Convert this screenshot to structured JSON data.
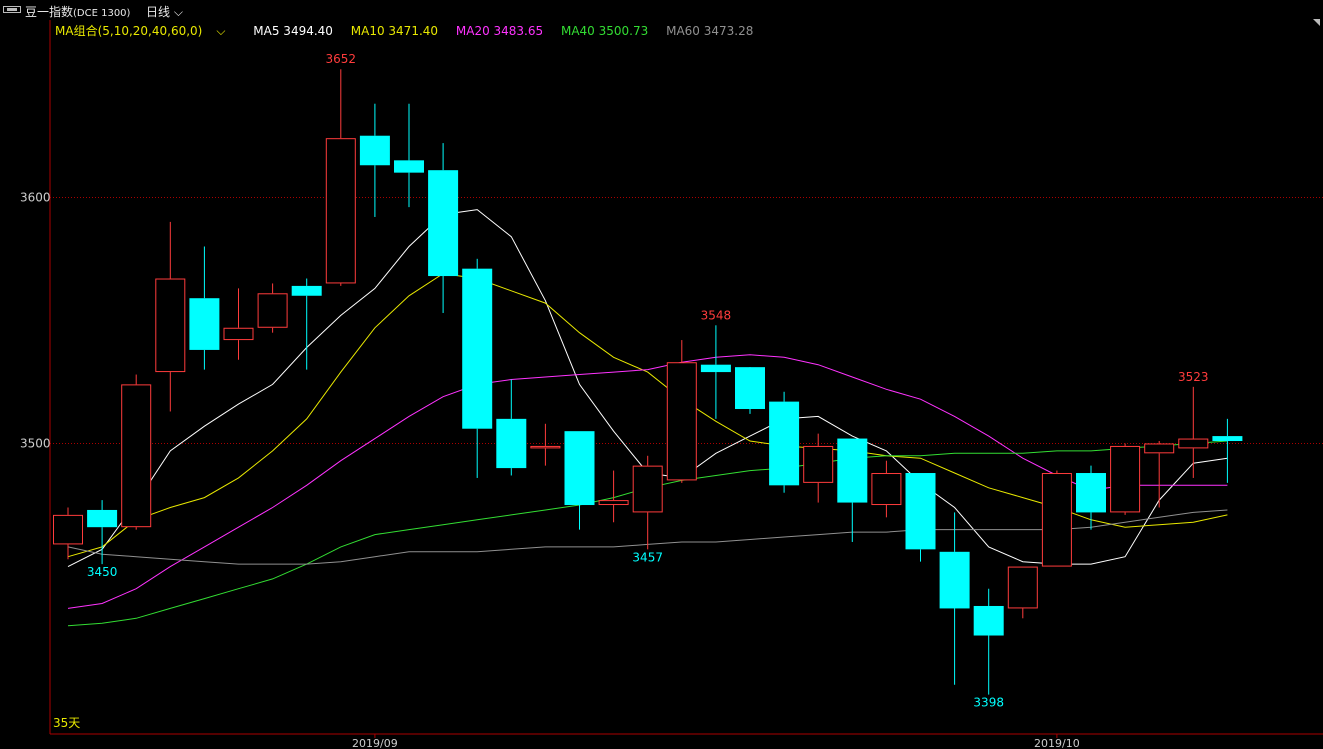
{
  "header": {
    "title": "豆一指数",
    "code": "(DCE 1300)",
    "period": "日线"
  },
  "ma_legend": {
    "combo": "MA组合(5,10,20,40,60,0)",
    "items": [
      {
        "label": "MA5 3494.40",
        "color": "#ffffff"
      },
      {
        "label": "MA10 3471.40",
        "color": "#e8e800"
      },
      {
        "label": "MA20 3483.65",
        "color": "#ff33ff"
      },
      {
        "label": "MA40 3500.73",
        "color": "#33dd33"
      },
      {
        "label": "MA60 3473.28",
        "color": "#909090"
      }
    ]
  },
  "footer": {
    "days": "35天"
  },
  "colors": {
    "up": "#ff3c3c",
    "down": "#00ffff",
    "ma5": "#ffffff",
    "ma10": "#e8e800",
    "ma20": "#ff33ff",
    "ma40": "#33dd33",
    "ma60": "#909090",
    "axis": "#aa0000",
    "grid": "#aa0000"
  },
  "chart_data": {
    "type": "candlestick",
    "y_ticks": [
      3600,
      3500
    ],
    "ylim": [
      3382,
      3672
    ],
    "x_tick_labels": [
      {
        "label": "2019/09",
        "index": 9
      },
      {
        "label": "2019/10",
        "index": 29
      }
    ],
    "annotations": [
      {
        "label": "3652",
        "index": 8,
        "kind": "high"
      },
      {
        "label": "3450",
        "index": 1,
        "kind": "low"
      },
      {
        "label": "3548",
        "index": 19,
        "kind": "high"
      },
      {
        "label": "3457",
        "index": 17,
        "kind": "low"
      },
      {
        "label": "3398",
        "index": 27,
        "kind": "low"
      },
      {
        "label": "3523",
        "index": 33,
        "kind": "high"
      }
    ],
    "candles": [
      {
        "o": 3459,
        "h": 3474,
        "l": 3453,
        "c": 3471
      },
      {
        "o": 3473,
        "h": 3477,
        "l": 3451,
        "c": 3466
      },
      {
        "o": 3466,
        "h": 3528,
        "l": 3465,
        "c": 3524
      },
      {
        "o": 3529,
        "h": 3590,
        "l": 3513,
        "c": 3567
      },
      {
        "o": 3559,
        "h": 3580,
        "l": 3530,
        "c": 3538
      },
      {
        "o": 3542,
        "h": 3563,
        "l": 3534,
        "c": 3547
      },
      {
        "o": 3547,
        "h": 3565,
        "l": 3545,
        "c": 3561
      },
      {
        "o": 3564,
        "h": 3567,
        "l": 3530,
        "c": 3560
      },
      {
        "o": 3565,
        "h": 3652,
        "l": 3564,
        "c": 3624
      },
      {
        "o": 3625,
        "h": 3638,
        "l": 3592,
        "c": 3613
      },
      {
        "o": 3615,
        "h": 3638,
        "l": 3596,
        "c": 3610
      },
      {
        "o": 3611,
        "h": 3622,
        "l": 3553,
        "c": 3568
      },
      {
        "o": 3571,
        "h": 3575,
        "l": 3486,
        "c": 3506
      },
      {
        "o": 3510,
        "h": 3526,
        "l": 3487,
        "c": 3490
      },
      {
        "o": 3498,
        "h": 3508,
        "l": 3491,
        "c": 3499
      },
      {
        "o": 3505,
        "h": 3505,
        "l": 3465,
        "c": 3475
      },
      {
        "o": 3475,
        "h": 3489,
        "l": 3468,
        "c": 3477
      },
      {
        "o": 3472,
        "h": 3495,
        "l": 3457,
        "c": 3491
      },
      {
        "o": 3485,
        "h": 3542,
        "l": 3484,
        "c": 3533
      },
      {
        "o": 3532,
        "h": 3548,
        "l": 3510,
        "c": 3529
      },
      {
        "o": 3531,
        "h": 3528,
        "l": 3512,
        "c": 3514
      },
      {
        "o": 3517,
        "h": 3521,
        "l": 3480,
        "c": 3483
      },
      {
        "o": 3484,
        "h": 3504,
        "l": 3476,
        "c": 3499
      },
      {
        "o": 3502,
        "h": 3502,
        "l": 3460,
        "c": 3476
      },
      {
        "o": 3475,
        "h": 3493,
        "l": 3470,
        "c": 3488
      },
      {
        "o": 3488,
        "h": 3488,
        "l": 3452,
        "c": 3457
      },
      {
        "o": 3456,
        "h": 3472,
        "l": 3402,
        "c": 3433
      },
      {
        "o": 3434,
        "h": 3441,
        "l": 3398,
        "c": 3422
      },
      {
        "o": 3433,
        "h": 3450,
        "l": 3429,
        "c": 3450
      },
      {
        "o": 3450,
        "h": 3489,
        "l": 3450,
        "c": 3488
      },
      {
        "o": 3488,
        "h": 3491,
        "l": 3465,
        "c": 3472
      },
      {
        "o": 3472,
        "h": 3500,
        "l": 3471,
        "c": 3499
      },
      {
        "o": 3496,
        "h": 3501,
        "l": 3474,
        "c": 3500
      },
      {
        "o": 3498,
        "h": 3523,
        "l": 3486,
        "c": 3502
      },
      {
        "o": 3503,
        "h": 3510,
        "l": 3484,
        "c": 3501
      }
    ],
    "series": [
      {
        "name": "MA5",
        "key": "ma5",
        "values": [
          3450,
          3457,
          3476,
          3497,
          3507,
          3516,
          3524,
          3539,
          3552,
          3563,
          3580,
          3593,
          3595,
          3584,
          3558,
          3524,
          3505,
          3488,
          3486,
          3496,
          3503,
          3510,
          3511,
          3503,
          3497,
          3484,
          3474,
          3458,
          3452,
          3451,
          3451,
          3454,
          3477,
          3492,
          3494
        ]
      },
      {
        "name": "MA10",
        "key": "ma10",
        "values": [
          3454,
          3458,
          3469,
          3474,
          3478,
          3486,
          3497,
          3510,
          3529,
          3547,
          3560,
          3569,
          3567,
          3562,
          3557,
          3545,
          3535,
          3529,
          3518,
          3509,
          3501,
          3499,
          3498,
          3497,
          3495,
          3494,
          3488,
          3482,
          3478,
          3474,
          3469,
          3466,
          3467,
          3468,
          3471
        ]
      },
      {
        "name": "MA20",
        "key": "ma20",
        "values": [
          3433,
          3435,
          3441,
          3450,
          3458,
          3466,
          3474,
          3483,
          3493,
          3502,
          3511,
          3519,
          3524,
          3526,
          3527,
          3528,
          3529,
          3530,
          3533,
          3535,
          3536,
          3535,
          3532,
          3527,
          3522,
          3518,
          3511,
          3503,
          3494,
          3487,
          3481,
          3483,
          3483,
          3483,
          3483
        ]
      },
      {
        "name": "MA40",
        "key": "ma40",
        "values": [
          3426,
          3427,
          3429,
          3433,
          3437,
          3441,
          3445,
          3451,
          3458,
          3463,
          3465,
          3467,
          3469,
          3471,
          3473,
          3475,
          3478,
          3482,
          3485,
          3487,
          3489,
          3490,
          3492,
          3494,
          3495,
          3495,
          3496,
          3496,
          3496,
          3497,
          3497,
          3498,
          3499,
          3500,
          3501
        ]
      },
      {
        "name": "MA60",
        "key": "ma60",
        "values": [
          3458,
          3455,
          3454,
          3453,
          3452,
          3451,
          3451,
          3451,
          3452,
          3454,
          3456,
          3456,
          3456,
          3457,
          3458,
          3458,
          3458,
          3459,
          3460,
          3460,
          3461,
          3462,
          3463,
          3464,
          3464,
          3465,
          3465,
          3465,
          3465,
          3465,
          3466,
          3468,
          3470,
          3472,
          3473
        ]
      }
    ]
  }
}
